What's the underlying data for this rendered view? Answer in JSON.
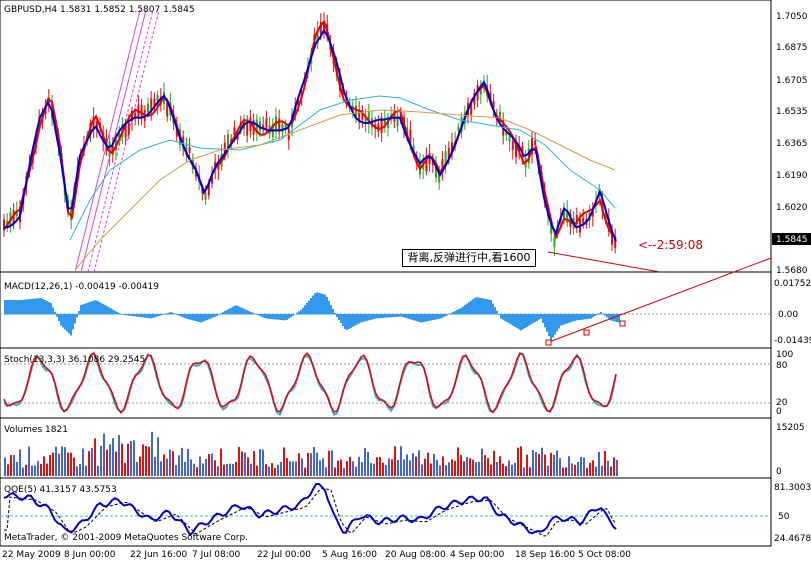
{
  "panels": {
    "main": {
      "title": "GBPUSD,H4  1.5831 1.5852 1.5807 1.5845",
      "axis_labels": [
        "1.7050",
        "1.6875",
        "1.6705",
        "1.6535",
        "1.6365",
        "1.6190",
        "1.6020",
        "1.5845",
        "1.5680"
      ],
      "current_price": "1.5845"
    },
    "macd": {
      "title": "MACD(12,26,1) -0.00419 -0.00419",
      "axis_labels": [
        "0.01752",
        "0.00",
        "-0.01439"
      ]
    },
    "stoch": {
      "title": "Stoch(13,3,3) 36.1086 29.2545",
      "axis_labels": [
        "100",
        "80",
        "20",
        "0"
      ]
    },
    "volumes": {
      "title": "Volumes 1821",
      "axis_labels": [
        "15205",
        "0"
      ]
    },
    "qqe": {
      "title": "QQE(5) 41.3157 43.5753",
      "axis_labels": [
        "81.3003",
        "50",
        "24.4678"
      ]
    }
  },
  "annotation": {
    "text": "背离,反弹进行中,看1600",
    "timer": "<--2:59:08"
  },
  "watermark": "MetaTrader, © 2001-2009 MetaQuotes Software Corp.",
  "time_axis": [
    "22 May 2009",
    "8 Jun 00:00",
    "22 Jun 16:00",
    "7 Jul 08:00",
    "22 Jul 00:00",
    "5 Aug 16:00",
    "20 Aug 08:00",
    "4 Sep 00:00",
    "18 Sep 16:00",
    "5 Oct 08:00"
  ],
  "colors": {
    "bull": "#22aa22",
    "bear": "#dd1111",
    "blue_ma": "#0000cc",
    "red_ma": "#ee0000",
    "cyan_ma": "#2bb5d6",
    "orange_ma": "#d79b4b",
    "channel": "#dd44dd",
    "macd_hist": "#3399ee"
  }
}
